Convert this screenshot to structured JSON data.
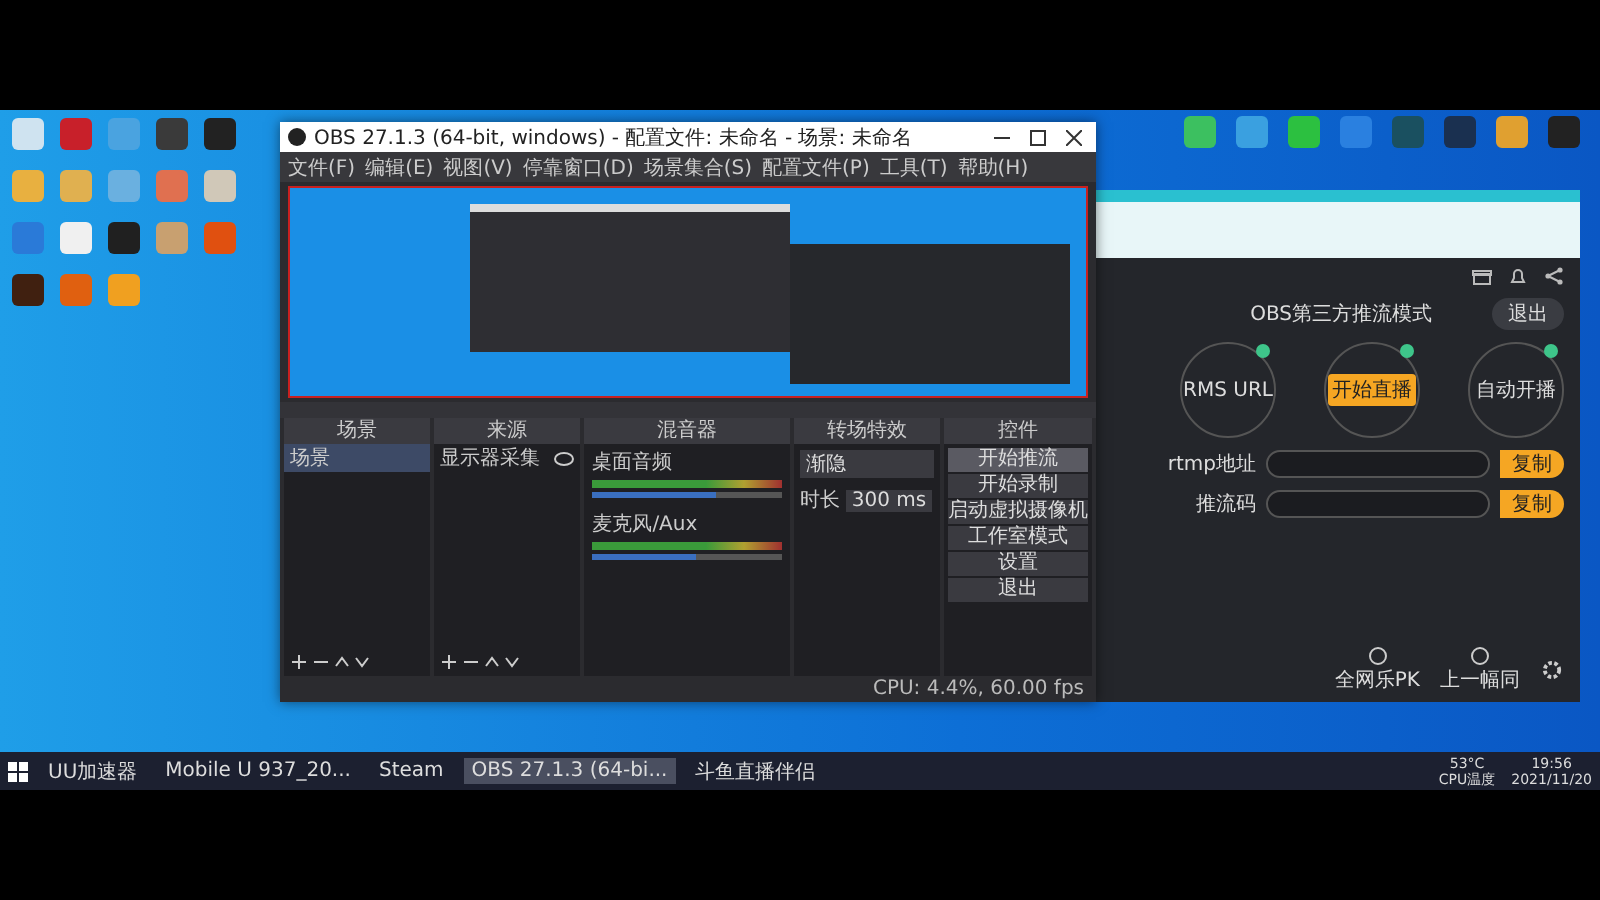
{
  "desktop": {
    "icons_left": [
      {
        "color": "#cfe3f0"
      },
      {
        "color": "#c8202a"
      },
      {
        "color": "#4aa3e0"
      },
      {
        "color": "#3a3a3a"
      },
      {
        "color": "#222222"
      },
      {
        "color": "#e8b040"
      },
      {
        "color": "#e0b050"
      },
      {
        "color": "#6ab0e0"
      },
      {
        "color": "#e07050"
      },
      {
        "color": "#d0c8b8"
      },
      {
        "color": "#2a7ad8"
      },
      {
        "color": "#f0f0f0"
      },
      {
        "color": "#202020"
      },
      {
        "color": "#c8a070"
      },
      {
        "color": "#e05010"
      },
      {
        "color": "#402010"
      },
      {
        "color": "#e06010"
      },
      {
        "color": "#f0a020"
      }
    ],
    "icons_right": [
      {
        "color": "#3cc060"
      },
      {
        "color": "#3aa0e0"
      },
      {
        "color": "#2cc040"
      },
      {
        "color": "#2a80e0"
      },
      {
        "color": "#1a5060"
      },
      {
        "color": "#1a3050"
      },
      {
        "color": "#e0a030"
      },
      {
        "color": "#222222"
      }
    ]
  },
  "obs": {
    "title": "OBS 27.1.3 (64-bit, windows) - 配置文件: 未命名 - 场景: 未命名",
    "menu": [
      "文件(F)",
      "编辑(E)",
      "视图(V)",
      "停靠窗口(D)",
      "场景集合(S)",
      "配置文件(P)",
      "工具(T)",
      "帮助(H)"
    ],
    "docks": {
      "scenes": {
        "title": "场景",
        "items": [
          {
            "label": "场景",
            "selected": true
          }
        ]
      },
      "sources": {
        "title": "来源",
        "items": [
          {
            "label": "显示器采集",
            "visible": true
          }
        ]
      },
      "mixer": {
        "title": "混音器",
        "channels": [
          {
            "name": "桌面音频",
            "level": 0.65
          },
          {
            "name": "麦克风/Aux",
            "level": 0.55
          }
        ]
      },
      "transitions": {
        "title": "转场特效",
        "mode": "渐隐",
        "duration_label": "时长",
        "duration": "300 ms"
      },
      "controls": {
        "title": "控件",
        "buttons": [
          {
            "label": "开始推流",
            "selected": true
          },
          {
            "label": "开始录制",
            "selected": false
          },
          {
            "label": "启动虚拟摄像机",
            "selected": false
          },
          {
            "label": "工作室模式",
            "selected": false
          },
          {
            "label": "设置",
            "selected": false
          },
          {
            "label": "退出",
            "selected": false
          }
        ]
      }
    },
    "status": "CPU: 4.4%, 60.00 fps"
  },
  "live_app": {
    "heading": "OBS第三方推流模式",
    "exit": "退出",
    "steps": [
      {
        "label": "RMS URL",
        "kind": "plain"
      },
      {
        "label": "开始直播",
        "kind": "button"
      },
      {
        "label": "自动开播",
        "kind": "plain"
      }
    ],
    "fields": [
      {
        "label": "rtmp地址",
        "action": "复制"
      },
      {
        "label": "推流码",
        "action": "复制"
      }
    ],
    "tools": [
      {
        "label": "全网乐PK"
      },
      {
        "label": "上一幅同"
      }
    ]
  },
  "taskbar": {
    "items": [
      {
        "label": "UU加速器",
        "selected": false
      },
      {
        "label": "Mobile U 937_20...",
        "selected": false
      },
      {
        "label": "Steam",
        "selected": false
      },
      {
        "label": "OBS 27.1.3 (64-bi...",
        "selected": true
      },
      {
        "label": "斗鱼直播伴侣",
        "selected": false
      }
    ],
    "temp": "53°C",
    "temp_label": "CPU温度",
    "time": "19:56",
    "date": "2021/11/20"
  }
}
